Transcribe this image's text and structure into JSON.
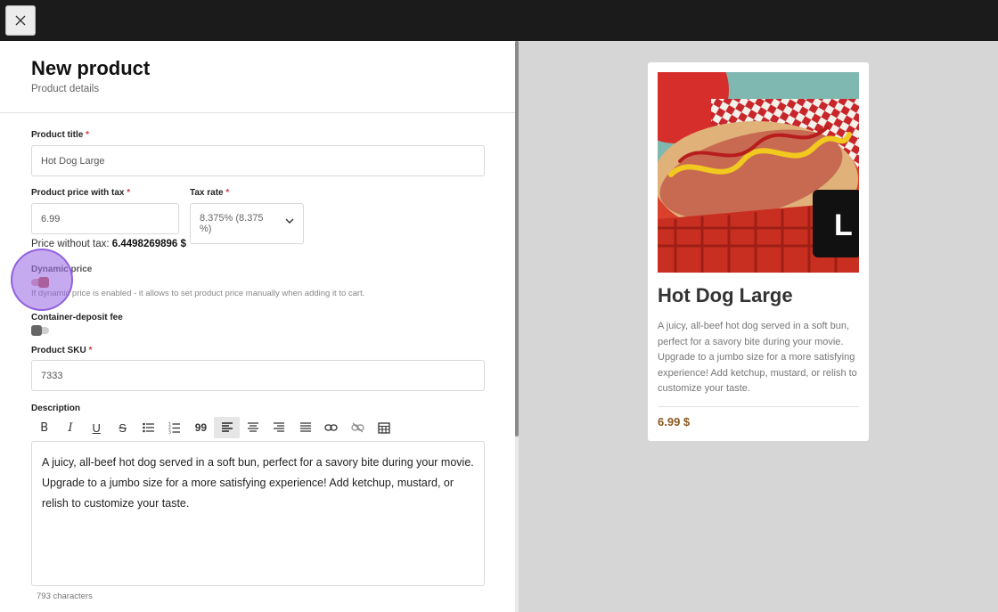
{
  "header": {
    "title": "New product",
    "subtitle": "Product details"
  },
  "form": {
    "title_label": "Product title",
    "title_value": "Hot Dog Large",
    "price_label": "Product price with tax",
    "price_value": "6.99",
    "tax_label": "Tax rate",
    "tax_value": "8.375% (8.375 %)",
    "price_without_tax_label": "Price without tax:",
    "price_without_tax_value": "6.4498269896 $",
    "dynamic_price_label": "Dynamic price",
    "dynamic_price_on": true,
    "dynamic_price_hint": "If dynamic price is enabled - it allows to set product price manually when adding it to cart.",
    "container_fee_label": "Container-deposit fee",
    "container_fee_on": false,
    "sku_label": "Product SKU",
    "sku_value": "7333",
    "description_label": "Description",
    "description_text": "A juicy, all-beef hot dog served in a soft bun, perfect for a savory bite during your movie. Upgrade to a jumbo size for a more satisfying experience! Add ketchup, mustard, or relish to customize your taste.",
    "char_count": "793 characters",
    "required_mark": "*"
  },
  "toolbar": {
    "bold": "B",
    "italic": "I",
    "underline": "U",
    "strike": "S",
    "quote": "99",
    "icons": [
      "bold-icon",
      "italic-icon",
      "underline-icon",
      "strikethrough-icon",
      "bullet-list-icon",
      "numbered-list-icon",
      "blockquote-icon",
      "align-left-icon",
      "align-center-icon",
      "align-right-icon",
      "align-justify-icon",
      "link-icon",
      "unlink-icon",
      "table-icon"
    ]
  },
  "preview": {
    "title": "Hot Dog Large",
    "description": "A juicy, all-beef hot dog served in a soft bun, perfect for a savory bite during your movie. Upgrade to a jumbo size for a more satisfying experience! Add ketchup, mustard, or relish to customize your taste.",
    "price": "6.99 $",
    "size_badge": "L"
  },
  "colors": {
    "topbar": "#1b1b1b",
    "price_accent": "#8a5a1e",
    "required": "#d13b3b",
    "cursor_halo": "#9664e1"
  }
}
